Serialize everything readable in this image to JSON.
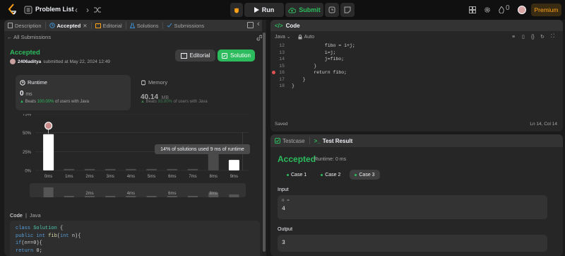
{
  "topbar": {
    "title": "Problem List",
    "run_label": "Run",
    "submit_label": "Submit",
    "coins": "0",
    "premium_label": "Premium"
  },
  "left_tabs": [
    {
      "label": "Description"
    },
    {
      "label": "Accepted"
    },
    {
      "label": "Editorial"
    },
    {
      "label": "Solutions"
    },
    {
      "label": "Submissions"
    }
  ],
  "submission": {
    "back_label": "All Submissions",
    "status": "Accepted",
    "user": "2406aditya",
    "submitted_text": "submitted at May 22, 2024 12:49",
    "editorial_label": "Editorial",
    "solution_label": "Solution"
  },
  "runtime": {
    "label": "Runtime",
    "value": "0",
    "unit": "ms",
    "beats_prefix": "Beats",
    "beats_value": "100.00%",
    "beats_suffix": "of users with Java"
  },
  "memory": {
    "label": "Memory",
    "value": "40.14",
    "unit": "MB",
    "beats_prefix": "Beats",
    "beats_value": "93.80%",
    "beats_suffix": "of users with Java"
  },
  "chart_data": {
    "type": "bar",
    "categories": [
      "0ms",
      "1ms",
      "2ms",
      "3ms",
      "4ms",
      "5ms",
      "6ms",
      "7ms",
      "8ms",
      "9ms"
    ],
    "values": [
      48,
      2,
      2,
      2,
      2,
      2,
      2,
      2,
      23,
      14
    ],
    "y_ticks": [
      "75%",
      "50%",
      "25%",
      "0%"
    ],
    "ylim": [
      0,
      75
    ],
    "ylabel": "",
    "xlabel": "",
    "tooltip": "14% of solutions used 9 ms of runtime",
    "overview_labels": [
      "2ms",
      "4ms",
      "6ms",
      "8ms"
    ]
  },
  "code_view": {
    "header": "Code",
    "language": "Java",
    "lines": [
      "class Solution {",
      "    public int fib(int n){",
      "        if(n==0){",
      "            return 0;"
    ]
  },
  "editor": {
    "title": "Code",
    "language": "Java",
    "autocomplete": "Auto",
    "line_numbers": [
      "12",
      "13",
      "14",
      "15",
      "16",
      "17",
      "18"
    ],
    "lines": [
      "            fibo = i+j;",
      "            i=j;",
      "            j=fibo;",
      "        }",
      "        return fibo;",
      "    }",
      "}"
    ],
    "saved_label": "Saved",
    "cursor_pos": "Ln 14, Col 14"
  },
  "result": {
    "testcase_tab": "Testcase",
    "result_tab": "Test Result",
    "status": "Accepted",
    "runtime": "Runtime: 0 ms",
    "cases": [
      "Case 1",
      "Case 2",
      "Case 3"
    ],
    "input_label": "Input",
    "input_var": "n =",
    "input_value": "4",
    "output_label": "Output",
    "output_value": "3"
  },
  "colors": {
    "accent_green": "#2cbb5d",
    "premium_orange": "#ffa116",
    "background": "#1a1a1a",
    "panel": "#262626"
  }
}
